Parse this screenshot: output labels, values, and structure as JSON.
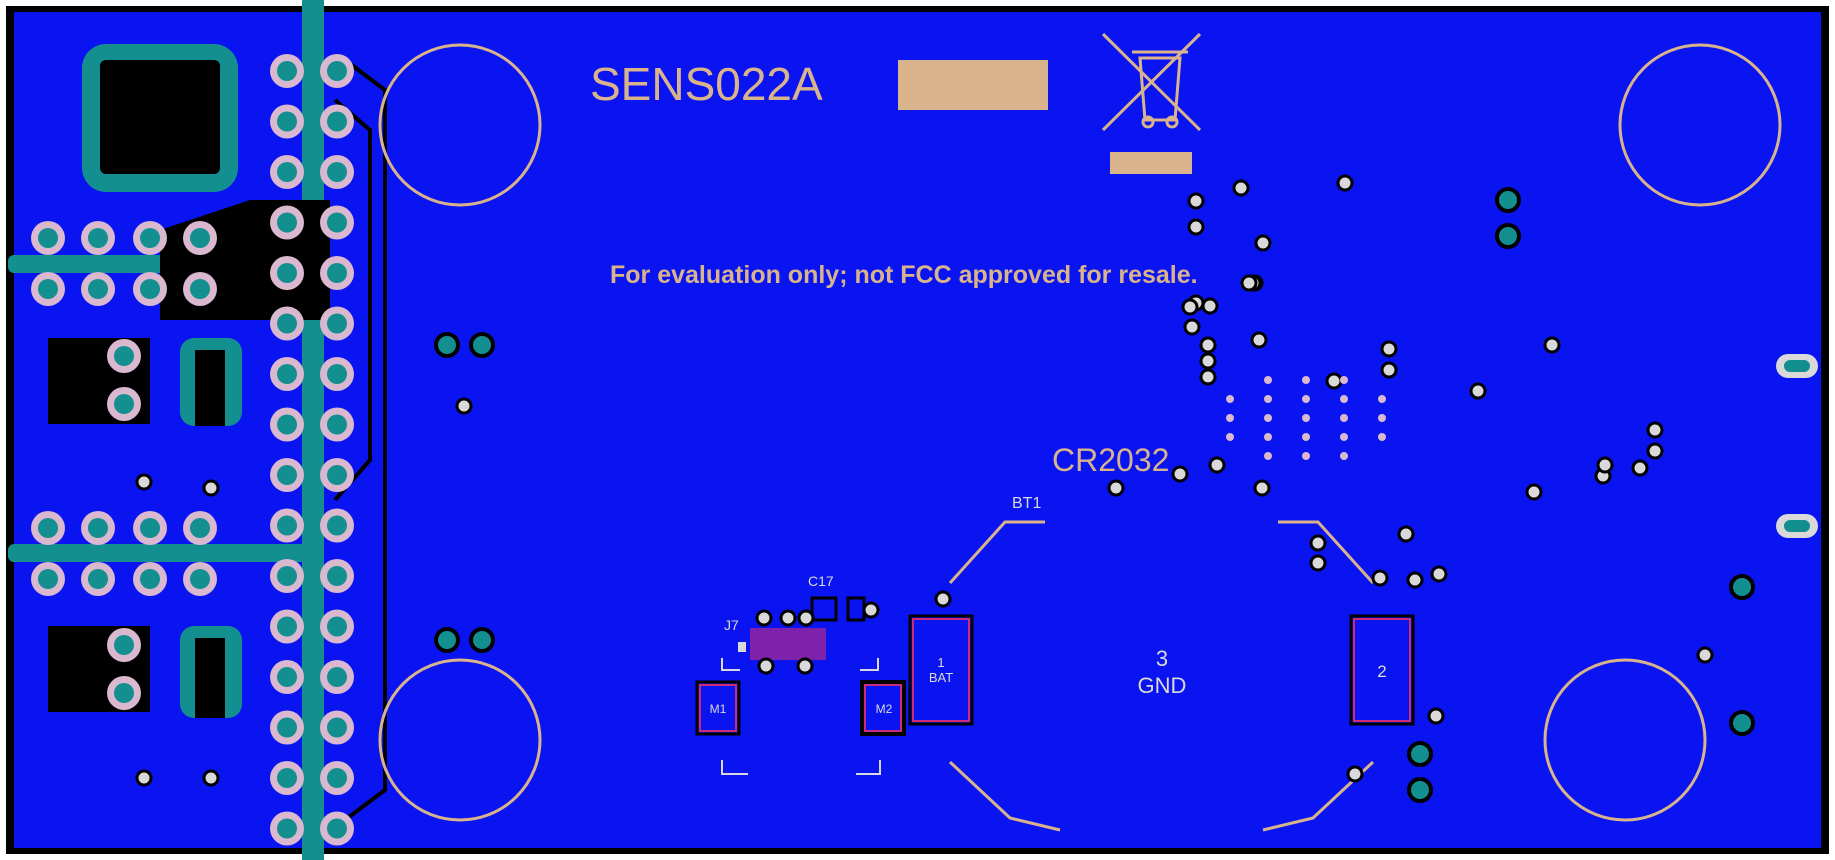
{
  "board": {
    "name": "SENS022A",
    "notice": "For evaluation only; not FCC approved for resale.",
    "battery_type": "CR2032",
    "battery_ref": "BT1",
    "cap_ref": "C17",
    "connector_ref": "J7",
    "pad1_label": "1",
    "pad1_sub": "BAT",
    "pad2_label": "2",
    "pad3_label": "3",
    "pad3_sub": "GND",
    "m1_label": "M1",
    "m2_label": "M2"
  },
  "colors": {
    "board": "#0a14f0",
    "silkscreen": "#d9b38c",
    "copper_pad": "#138f8f",
    "outline": "#000000"
  }
}
